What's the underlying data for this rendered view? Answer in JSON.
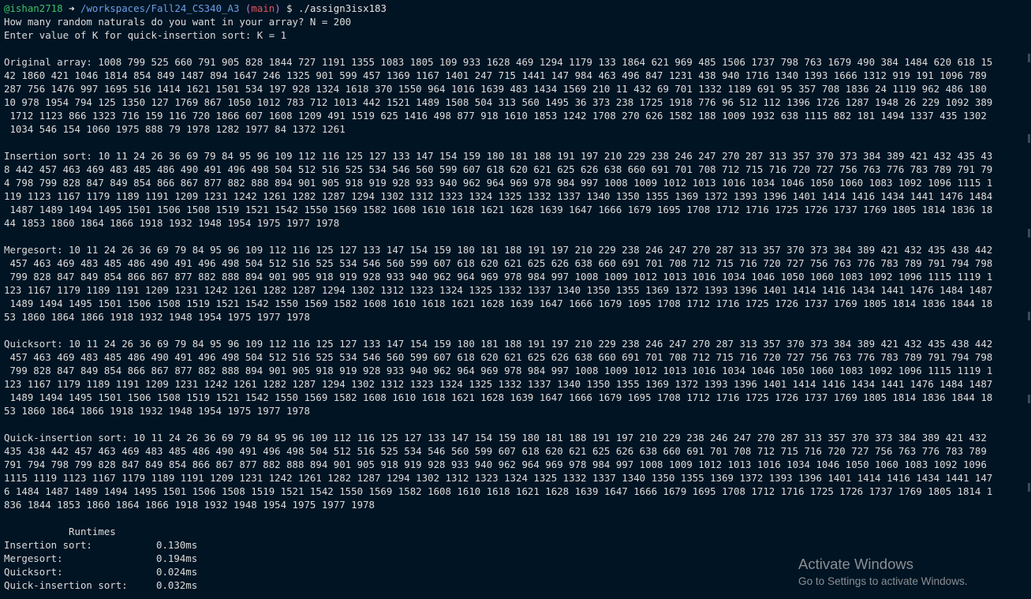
{
  "prompt": {
    "user": "@ishan2718",
    "arrow": " ➜",
    "path": "/workspaces/Fall24_CS340_A3",
    "branch_open": "(",
    "branch": "main",
    "branch_close": ")",
    "command": " $ ./assign3isx183"
  },
  "inputs": {
    "n_prompt": "How many random naturals do you want in your array? N = 200",
    "k_prompt": "Enter value of K for quick-insertion sort: K = 1"
  },
  "original": [
    "Original array: 1008 799 525 660 791 905 828 1844 727 1191 1355 1083 1805 109 933 1628 469 1294 1179 133 1864 621 969 485 1506 1737 798 763 1679 490 384 1484 620 618 15",
    "42 1860 421 1046 1814 854 849 1487 894 1647 246 1325 901 599 457 1369 1167 1401 247 715 1441 147 984 463 496 847 1231 438 940 1716 1340 1393 1666 1312 919 191 1096 789",
    "287 756 1476 997 1695 516 1414 1621 1501 534 197 928 1324 1618 370 1550 964 1016 1639 483 1434 1569 210 11 432 69 701 1332 1189 691 95 357 708 1836 24 1119 962 486 180",
    "10 978 1954 794 125 1350 127 1769 867 1050 1012 783 712 1013 442 1521 1489 1508 504 313 560 1495 36 373 238 1725 1918 776 96 512 112 1396 1726 1287 1948 26 229 1092 389",
    " 1712 1123 866 1323 716 159 116 720 1866 607 1608 1209 491 1519 625 1416 498 877 918 1610 1853 1242 1708 270 626 1582 188 1009 1932 638 1115 882 181 1494 1337 435 1302",
    " 1034 546 154 1060 1975 888 79 1978 1282 1977 84 1372 1261"
  ],
  "insertion": [
    "Insertion sort: 10 11 24 26 36 69 79 84 95 96 109 112 116 125 127 133 147 154 159 180 181 188 191 197 210 229 238 246 247 270 287 313 357 370 373 384 389 421 432 435 43",
    "8 442 457 463 469 483 485 486 490 491 496 498 504 512 516 525 534 546 560 599 607 618 620 621 625 626 638 660 691 701 708 712 715 716 720 727 756 763 776 783 789 791 79",
    "4 798 799 828 847 849 854 866 867 877 882 888 894 901 905 918 919 928 933 940 962 964 969 978 984 997 1008 1009 1012 1013 1016 1034 1046 1050 1060 1083 1092 1096 1115 1",
    "119 1123 1167 1179 1189 1191 1209 1231 1242 1261 1282 1287 1294 1302 1312 1323 1324 1325 1332 1337 1340 1350 1355 1369 1372 1393 1396 1401 1414 1416 1434 1441 1476 1484",
    " 1487 1489 1494 1495 1501 1506 1508 1519 1521 1542 1550 1569 1582 1608 1610 1618 1621 1628 1639 1647 1666 1679 1695 1708 1712 1716 1725 1726 1737 1769 1805 1814 1836 18",
    "44 1853 1860 1864 1866 1918 1932 1948 1954 1975 1977 1978"
  ],
  "mergesort": [
    "Mergesort: 10 11 24 26 36 69 79 84 95 96 109 112 116 125 127 133 147 154 159 180 181 188 191 197 210 229 238 246 247 270 287 313 357 370 373 384 389 421 432 435 438 442",
    " 457 463 469 483 485 486 490 491 496 498 504 512 516 525 534 546 560 599 607 618 620 621 625 626 638 660 691 701 708 712 715 716 720 727 756 763 776 783 789 791 794 798",
    " 799 828 847 849 854 866 867 877 882 888 894 901 905 918 919 928 933 940 962 964 969 978 984 997 1008 1009 1012 1013 1016 1034 1046 1050 1060 1083 1092 1096 1115 1119 1",
    "123 1167 1179 1189 1191 1209 1231 1242 1261 1282 1287 1294 1302 1312 1323 1324 1325 1332 1337 1340 1350 1355 1369 1372 1393 1396 1401 1414 1416 1434 1441 1476 1484 1487",
    " 1489 1494 1495 1501 1506 1508 1519 1521 1542 1550 1569 1582 1608 1610 1618 1621 1628 1639 1647 1666 1679 1695 1708 1712 1716 1725 1726 1737 1769 1805 1814 1836 1844 18",
    "53 1860 1864 1866 1918 1932 1948 1954 1975 1977 1978"
  ],
  "quicksort": [
    "Quicksort: 10 11 24 26 36 69 79 84 95 96 109 112 116 125 127 133 147 154 159 180 181 188 191 197 210 229 238 246 247 270 287 313 357 370 373 384 389 421 432 435 438 442",
    " 457 463 469 483 485 486 490 491 496 498 504 512 516 525 534 546 560 599 607 618 620 621 625 626 638 660 691 701 708 712 715 716 720 727 756 763 776 783 789 791 794 798",
    " 799 828 847 849 854 866 867 877 882 888 894 901 905 918 919 928 933 940 962 964 969 978 984 997 1008 1009 1012 1013 1016 1034 1046 1050 1060 1083 1092 1096 1115 1119 1",
    "123 1167 1179 1189 1191 1209 1231 1242 1261 1282 1287 1294 1302 1312 1323 1324 1325 1332 1337 1340 1350 1355 1369 1372 1393 1396 1401 1414 1416 1434 1441 1476 1484 1487",
    " 1489 1494 1495 1501 1506 1508 1519 1521 1542 1550 1569 1582 1608 1610 1618 1621 1628 1639 1647 1666 1679 1695 1708 1712 1716 1725 1726 1737 1769 1805 1814 1836 1844 18",
    "53 1860 1864 1866 1918 1932 1948 1954 1975 1977 1978"
  ],
  "quickinsertion": [
    "Quick-insertion sort: 10 11 24 26 36 69 79 84 95 96 109 112 116 125 127 133 147 154 159 180 181 188 191 197 210 229 238 246 247 270 287 313 357 370 373 384 389 421 432",
    "435 438 442 457 463 469 483 485 486 490 491 496 498 504 512 516 525 534 546 560 599 607 618 620 621 625 626 638 660 691 701 708 712 715 716 720 727 756 763 776 783 789",
    "791 794 798 799 828 847 849 854 866 867 877 882 888 894 901 905 918 919 928 933 940 962 964 969 978 984 997 1008 1009 1012 1013 1016 1034 1046 1050 1060 1083 1092 1096",
    "1115 1119 1123 1167 1179 1189 1191 1209 1231 1242 1261 1282 1287 1294 1302 1312 1323 1324 1325 1332 1337 1340 1350 1355 1369 1372 1393 1396 1401 1414 1416 1434 1441 147",
    "6 1484 1487 1489 1494 1495 1501 1506 1508 1519 1521 1542 1550 1569 1582 1608 1610 1618 1621 1628 1639 1647 1666 1679 1695 1708 1712 1716 1725 1726 1737 1769 1805 1814 1",
    "836 1844 1853 1860 1864 1866 1918 1932 1948 1954 1975 1977 1978"
  ],
  "runtimes": {
    "heading": "           Runtimes",
    "rows": [
      {
        "label": "Insertion sort:",
        "value": "0.130ms"
      },
      {
        "label": "Mergesort:",
        "value": "0.194ms"
      },
      {
        "label": "Quicksort:",
        "value": "0.024ms"
      },
      {
        "label": "Quick-insertion sort:",
        "value": "0.032ms"
      }
    ]
  },
  "watermark": {
    "title": "Activate Windows",
    "subtitle": "Go to Settings to activate Windows."
  }
}
